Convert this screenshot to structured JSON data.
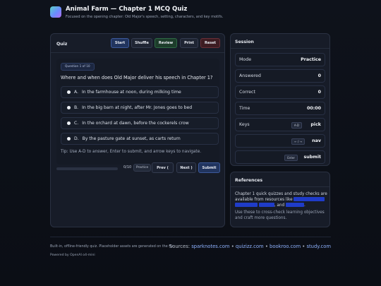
{
  "header": {
    "title": "Animal Farm — Chapter 1 MCQ Quiz",
    "subtitle": "Focused on the opening chapter: Old Major's speech, setting, characters, and key motifs."
  },
  "quiz": {
    "panel_title": "Quiz",
    "toolbar": {
      "start": "Start",
      "shuffle": "Shuffle",
      "review": "Review",
      "print": "Print",
      "reset": "Reset"
    },
    "question_badge": "Question 1 of 10",
    "question": "Where and when does Old Major deliver his speech in Chapter 1?",
    "options": [
      {
        "letter": "A.",
        "text": "In the farmhouse at noon, during milking time"
      },
      {
        "letter": "B.",
        "text": "In the big barn at night, after Mr. Jones goes to bed"
      },
      {
        "letter": "C.",
        "text": "In the orchard at dawn, before the cockerels crow"
      },
      {
        "letter": "D.",
        "text": "By the pasture gate at sunset, as carts return"
      }
    ],
    "tip": "Tip: Use A-D to answer, Enter to submit, and arrow keys to navigate.",
    "progress_fraction": 0.0,
    "progress_count": "0/10",
    "progress_mode": "Practice",
    "nav": {
      "prev": "Prev (",
      "next": "Next )",
      "submit": "Submit"
    }
  },
  "session": {
    "panel_title": "Session",
    "rows": [
      {
        "key": "Mode",
        "value": "Practice"
      },
      {
        "key": "Answered",
        "value": "0"
      },
      {
        "key": "Correct",
        "value": "0"
      },
      {
        "key": "Time",
        "value": "00:00"
      }
    ],
    "shortcuts": [
      {
        "label": "Keys",
        "kbd": "A-D",
        "action": "pick"
      },
      {
        "label": "",
        "kbd": "← / →",
        "action": "nav"
      },
      {
        "label": "",
        "kbd": "Enter",
        "action": "submit"
      }
    ]
  },
  "references": {
    "panel_title": "References",
    "text_before": "Chapter 1 quick quizzes and study checks are available from resources like",
    "text_and": ", and",
    "text_end": ".",
    "note": "Use these to cross-check learning objectives and craft more questions."
  },
  "footer": {
    "note": "Built-in, offline-friendly quiz. Placeholder assets are generated on the fly.",
    "powered": "Powered by OpenAI o4-mini",
    "sources_label": "Sources:",
    "sources": [
      "sparknotes.com",
      "quizizz.com",
      "bookroo.com",
      "study.com"
    ],
    "separator": " • "
  },
  "colors": {
    "accent": "#5b7bd6",
    "start_bg": "#21345e",
    "review_bg": "#1d3d2b",
    "reset_bg": "#3d1c22",
    "link": "#8fb2ff",
    "redacted_link": "#1f3cc9"
  }
}
